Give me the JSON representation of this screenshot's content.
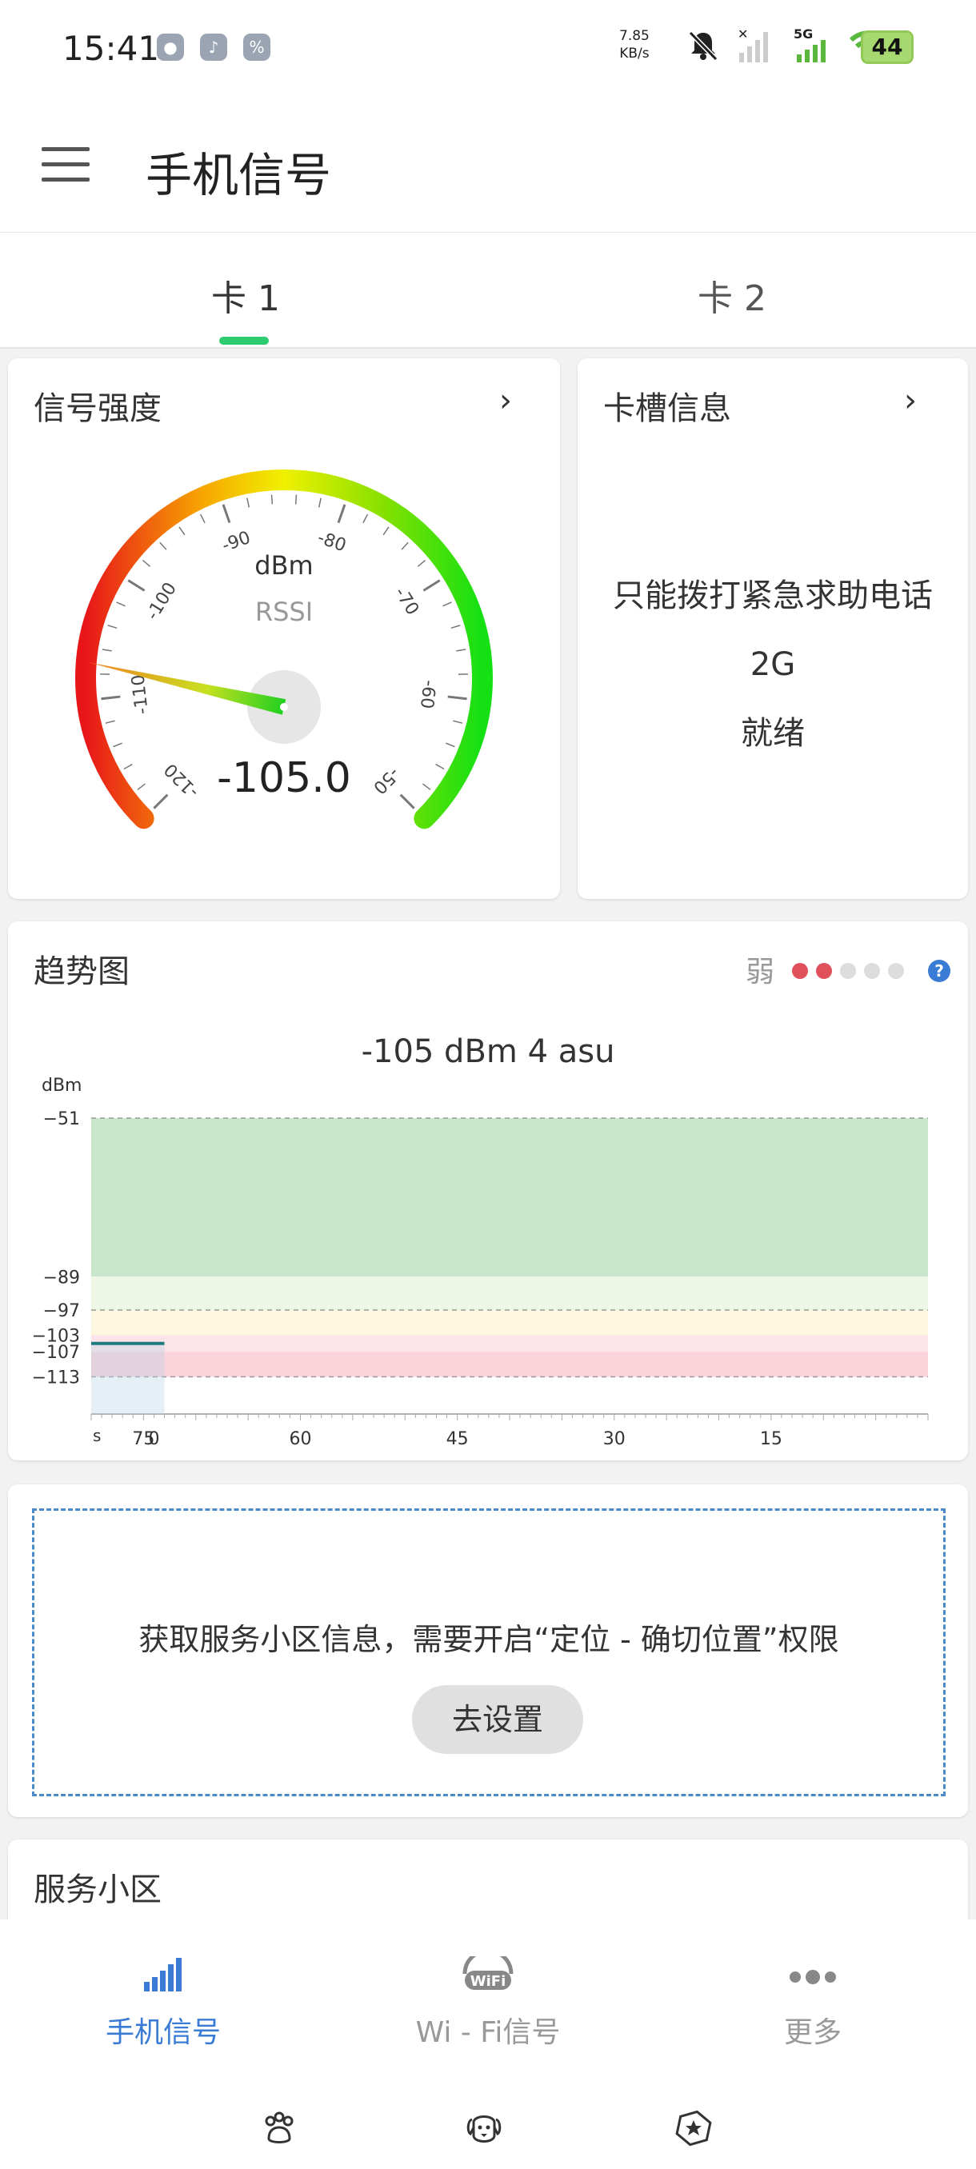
{
  "status_bar": {
    "time": "15:41",
    "net_speed_value": "7.85",
    "net_speed_unit": "KB/s",
    "network_type": "5G",
    "battery": "44",
    "icons": [
      "chat-app-icon",
      "tiktok-app-icon",
      "photo-app-icon",
      "mute-bell-icon",
      "no-signal-icon",
      "signal-5g-icon",
      "wifi-icon"
    ]
  },
  "app_bar": {
    "title": "手机信号",
    "menu_icon": "hamburger-menu-icon"
  },
  "tabs": [
    {
      "label": "卡 1",
      "active": true
    },
    {
      "label": "卡 2",
      "active": false
    }
  ],
  "signal_card": {
    "title": "信号强度",
    "unit": "dBm",
    "metric": "RSSI",
    "value_text": "-105.0",
    "value": -105.0,
    "scale_min": -120,
    "scale_max": -50,
    "scale_labels": [
      "-120",
      "-110",
      "-100",
      "-90",
      "-80",
      "-70",
      "-60",
      "-50"
    ]
  },
  "slot_card": {
    "title": "卡槽信息",
    "lines": [
      "只能拨打紧急求助电话",
      "2G",
      "就绪"
    ]
  },
  "trend_card": {
    "title": "趋势图",
    "strength_label": "弱",
    "strength_level": 2,
    "strength_max": 5,
    "help_symbol": "?",
    "current_text": "-105 dBm  4 asu"
  },
  "chart_data": {
    "type": "line",
    "ylabel": "dBm",
    "xlabel": "s",
    "y_ticks": [
      "-51",
      "-89",
      "-97",
      "-103",
      "-107",
      "-113"
    ],
    "x_ticks": [
      "75",
      "60",
      "45",
      "30",
      "15"
    ],
    "extra_x_tick": "0",
    "ylim": [
      -120,
      -51
    ],
    "xlim": [
      80,
      0
    ],
    "bands": [
      {
        "from": -89,
        "to": -51,
        "color": "#c8e6c9"
      },
      {
        "from": -97,
        "to": -89,
        "color": "#eef6e6"
      },
      {
        "from": -103,
        "to": -97,
        "color": "#fdf7e0"
      },
      {
        "from": -107,
        "to": -103,
        "color": "#fce4ea"
      },
      {
        "from": -113,
        "to": -107,
        "color": "#fbd3da"
      }
    ],
    "series": [
      {
        "x": [
          80,
          73
        ],
        "y": [
          -105,
          -105
        ]
      }
    ],
    "grid": false
  },
  "permission_card": {
    "message": "获取服务小区信息，需要开启“定位 - 确切位置”权限",
    "button": "去设置"
  },
  "cell_card": {
    "title": "服务小区"
  },
  "bottom_nav": [
    {
      "label": "手机信号",
      "icon": "signal-bars-icon",
      "active": true
    },
    {
      "label": "Wi - Fi信号",
      "icon": "wifi-badge-icon",
      "active": false
    },
    {
      "label": "更多",
      "icon": "more-dots-icon",
      "active": false
    }
  ],
  "colors": {
    "accent": "#3a7bd5",
    "tab_indicator": "#2ecc71",
    "weak_dot": "#e0505a",
    "inactive_dot": "#dddddd"
  }
}
